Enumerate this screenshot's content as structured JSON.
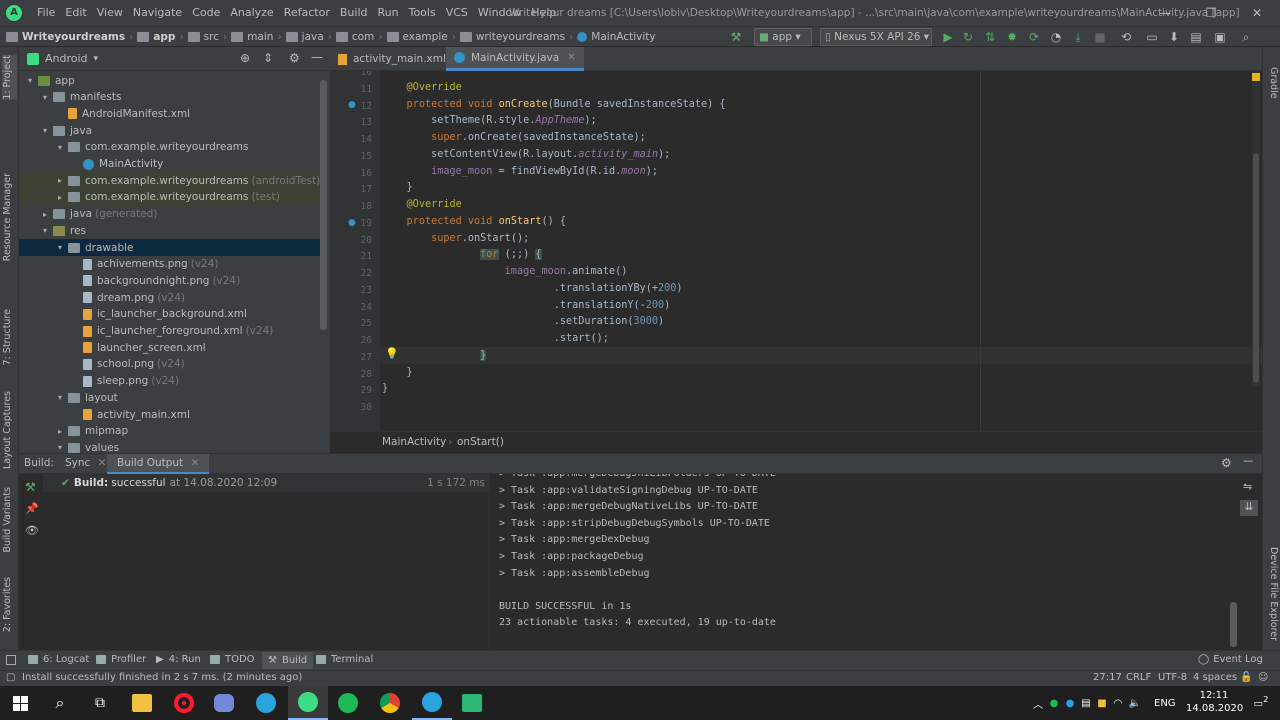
{
  "app": {
    "logo_glyph": "A",
    "menu": [
      "File",
      "Edit",
      "View",
      "Navigate",
      "Code",
      "Analyze",
      "Refactor",
      "Build",
      "Run",
      "Tools",
      "VCS",
      "Window",
      "Help"
    ],
    "window_title": "Write your dreams [C:\\Users\\lobiv\\Desktop\\Writeyourdreams\\app] - ...\\src\\main\\java\\com\\example\\writeyourdreams\\MainActivity.java [app]",
    "window_controls": {
      "minimize": "—",
      "restore": "❐",
      "close": "✕"
    }
  },
  "navbar": {
    "breadcrumbs": [
      "Writeyourdreams",
      "app",
      "src",
      "main",
      "java",
      "com",
      "example",
      "writeyourdreams",
      "MainActivity"
    ],
    "run_config": "app",
    "device": "Nexus 5X API 26"
  },
  "project": {
    "view_mode": "Android",
    "tree": [
      {
        "label": "app",
        "dim": "",
        "level": 0,
        "icon": "app",
        "arrow": "▾",
        "state": ""
      },
      {
        "label": "manifests",
        "dim": "",
        "level": 1,
        "icon": "folder",
        "arrow": "▾",
        "state": ""
      },
      {
        "label": "AndroidManifest.xml",
        "dim": "",
        "level": 2,
        "icon": "xml",
        "arrow": "",
        "state": ""
      },
      {
        "label": "java",
        "dim": "",
        "level": 1,
        "icon": "folder",
        "arrow": "▾",
        "state": ""
      },
      {
        "label": "com.example.writeyourdreams",
        "dim": "",
        "level": 2,
        "icon": "folder",
        "arrow": "▾",
        "state": ""
      },
      {
        "label": "MainActivity",
        "dim": "",
        "level": 3,
        "icon": "java",
        "arrow": "",
        "state": ""
      },
      {
        "label": "com.example.writeyourdreams",
        "dim": "(androidTest)",
        "level": 2,
        "icon": "folder",
        "arrow": "▸",
        "state": "green"
      },
      {
        "label": "com.example.writeyourdreams",
        "dim": "(test)",
        "level": 2,
        "icon": "folder",
        "arrow": "▸",
        "state": "green"
      },
      {
        "label": "java",
        "dim": "(generated)",
        "level": 1,
        "icon": "folder",
        "arrow": "▸",
        "state": ""
      },
      {
        "label": "res",
        "dim": "",
        "level": 1,
        "icon": "res",
        "arrow": "▾",
        "state": ""
      },
      {
        "label": "drawable",
        "dim": "",
        "level": 2,
        "icon": "folder",
        "arrow": "▾",
        "state": "sel"
      },
      {
        "label": "achivements.png",
        "dim": "(v24)",
        "level": 3,
        "icon": "file",
        "arrow": "",
        "state": ""
      },
      {
        "label": "backgroundnight.png",
        "dim": "(v24)",
        "level": 3,
        "icon": "file",
        "arrow": "",
        "state": ""
      },
      {
        "label": "dream.png",
        "dim": "(v24)",
        "level": 3,
        "icon": "file",
        "arrow": "",
        "state": ""
      },
      {
        "label": "ic_launcher_background.xml",
        "dim": "",
        "level": 3,
        "icon": "xml",
        "arrow": "",
        "state": ""
      },
      {
        "label": "ic_launcher_foreground.xml",
        "dim": "(v24)",
        "level": 3,
        "icon": "xml",
        "arrow": "",
        "state": ""
      },
      {
        "label": "launcher_screen.xml",
        "dim": "",
        "level": 3,
        "icon": "xml",
        "arrow": "",
        "state": ""
      },
      {
        "label": "school.png",
        "dim": "(v24)",
        "level": 3,
        "icon": "file",
        "arrow": "",
        "state": ""
      },
      {
        "label": "sleep.png",
        "dim": "(v24)",
        "level": 3,
        "icon": "file",
        "arrow": "",
        "state": ""
      },
      {
        "label": "layout",
        "dim": "",
        "level": 2,
        "icon": "folder",
        "arrow": "▾",
        "state": ""
      },
      {
        "label": "activity_main.xml",
        "dim": "",
        "level": 3,
        "icon": "xml",
        "arrow": "",
        "state": ""
      },
      {
        "label": "mipmap",
        "dim": "",
        "level": 2,
        "icon": "folder",
        "arrow": "▸",
        "state": ""
      },
      {
        "label": "values",
        "dim": "",
        "level": 2,
        "icon": "folder",
        "arrow": "▾",
        "state": ""
      }
    ]
  },
  "left_stripe": [
    "1: Project",
    "Resource Manager",
    "7: Structure",
    "Layout Captures",
    "Build Variants",
    "2: Favorites"
  ],
  "right_stripe": [
    "Gradle",
    "Device File Explorer"
  ],
  "editor": {
    "tabs": [
      {
        "label": "activity_main.xml",
        "active": false
      },
      {
        "label": "MainActivity.java",
        "active": true
      }
    ],
    "lines": [
      {
        "n": "10",
        "tokens": []
      },
      {
        "n": "11",
        "tokens": [
          {
            "t": "    "
          },
          {
            "t": "@Override",
            "c": "an"
          }
        ]
      },
      {
        "n": "12",
        "tokens": [
          {
            "t": "    "
          },
          {
            "t": "protected void ",
            "c": "kw"
          },
          {
            "t": "onCreate",
            "c": "fn"
          },
          {
            "t": "(Bundle savedInstanceState) {"
          }
        ]
      },
      {
        "n": "13",
        "tokens": [
          {
            "t": "        setTheme(R.style."
          },
          {
            "t": "AppTheme",
            "c": "ita"
          },
          {
            "t": ");"
          }
        ]
      },
      {
        "n": "14",
        "tokens": [
          {
            "t": "        "
          },
          {
            "t": "super",
            "c": "kw"
          },
          {
            "t": ".onCreate(savedInstanceState);"
          }
        ]
      },
      {
        "n": "15",
        "tokens": [
          {
            "t": "        setContentView(R.layout."
          },
          {
            "t": "activity_main",
            "c": "ita"
          },
          {
            "t": ");"
          }
        ]
      },
      {
        "n": "16",
        "tokens": [
          {
            "t": "        "
          },
          {
            "t": "image_moon",
            "c": "fld"
          },
          {
            "t": " = findViewById(R.id."
          },
          {
            "t": "moon",
            "c": "ita"
          },
          {
            "t": ");"
          }
        ]
      },
      {
        "n": "17",
        "tokens": [
          {
            "t": "    }"
          }
        ]
      },
      {
        "n": "18",
        "tokens": [
          {
            "t": "    "
          },
          {
            "t": "@Override",
            "c": "an"
          }
        ]
      },
      {
        "n": "19",
        "tokens": [
          {
            "t": "    "
          },
          {
            "t": "protected void ",
            "c": "kw"
          },
          {
            "t": "onStart",
            "c": "fn"
          },
          {
            "t": "() {"
          }
        ]
      },
      {
        "n": "20",
        "tokens": [
          {
            "t": "        "
          },
          {
            "t": "super",
            "c": "kw"
          },
          {
            "t": ".onStart();"
          }
        ]
      },
      {
        "n": "21",
        "tokens": [
          {
            "t": "                "
          },
          {
            "t": "for",
            "c": "kw hl"
          },
          {
            "t": " (;;) "
          },
          {
            "t": "{",
            "c": "hl"
          }
        ]
      },
      {
        "n": "22",
        "tokens": [
          {
            "t": "                    "
          },
          {
            "t": "image_moon",
            "c": "fld"
          },
          {
            "t": ".animate()"
          }
        ]
      },
      {
        "n": "23",
        "tokens": [
          {
            "t": "                            .translationYBy(+"
          },
          {
            "t": "200",
            "c": "num"
          },
          {
            "t": ")"
          }
        ]
      },
      {
        "n": "24",
        "tokens": [
          {
            "t": "                            .translationY(-"
          },
          {
            "t": "200",
            "c": "num"
          },
          {
            "t": ")"
          }
        ]
      },
      {
        "n": "25",
        "tokens": [
          {
            "t": "                            .setDuration("
          },
          {
            "t": "3000",
            "c": "num"
          },
          {
            "t": ")"
          }
        ]
      },
      {
        "n": "26",
        "tokens": [
          {
            "t": "                            .start();"
          }
        ]
      },
      {
        "n": "27",
        "tokens": [
          {
            "t": "                "
          },
          {
            "t": "}",
            "c": "hl"
          }
        ]
      },
      {
        "n": "28",
        "tokens": [
          {
            "t": "    }"
          }
        ]
      },
      {
        "n": "29",
        "tokens": [
          {
            "t": "}"
          }
        ]
      },
      {
        "n": "30",
        "tokens": []
      }
    ],
    "breadcrumb": [
      "MainActivity",
      "onStart()"
    ]
  },
  "build": {
    "label": "Build:",
    "tabs": [
      "Sync",
      "Build Output"
    ],
    "result_bold": "Build:",
    "result_text": "successful",
    "result_time": "at 14.08.2020 12:09",
    "duration": "1 s 172 ms",
    "output": [
      "> Task :app:mergeDebugJniLibFolders UP-TO-DATE",
      "> Task :app:validateSigningDebug UP-TO-DATE",
      "> Task :app:mergeDebugNativeLibs UP-TO-DATE",
      "> Task :app:stripDebugDebugSymbols UP-TO-DATE",
      "> Task :app:mergeDexDebug",
      "> Task :app:packageDebug",
      "> Task :app:assembleDebug",
      "",
      "BUILD SUCCESSFUL in 1s",
      "23 actionable tasks: 4 executed, 19 up-to-date"
    ]
  },
  "tool_windows": [
    "6: Logcat",
    "Profiler",
    "4: Run",
    "TODO",
    "Build",
    "Terminal"
  ],
  "event_log": "Event Log",
  "status": {
    "message": "Install successfully finished in 2 s 7 ms. (2 minutes ago)",
    "position": "27:17",
    "line_sep": "CRLF",
    "encoding": "UTF-8",
    "indent": "4 spaces"
  },
  "taskbar": {
    "language": "ENG",
    "time": "12:11",
    "date": "14.08.2020",
    "notifications": "2"
  }
}
